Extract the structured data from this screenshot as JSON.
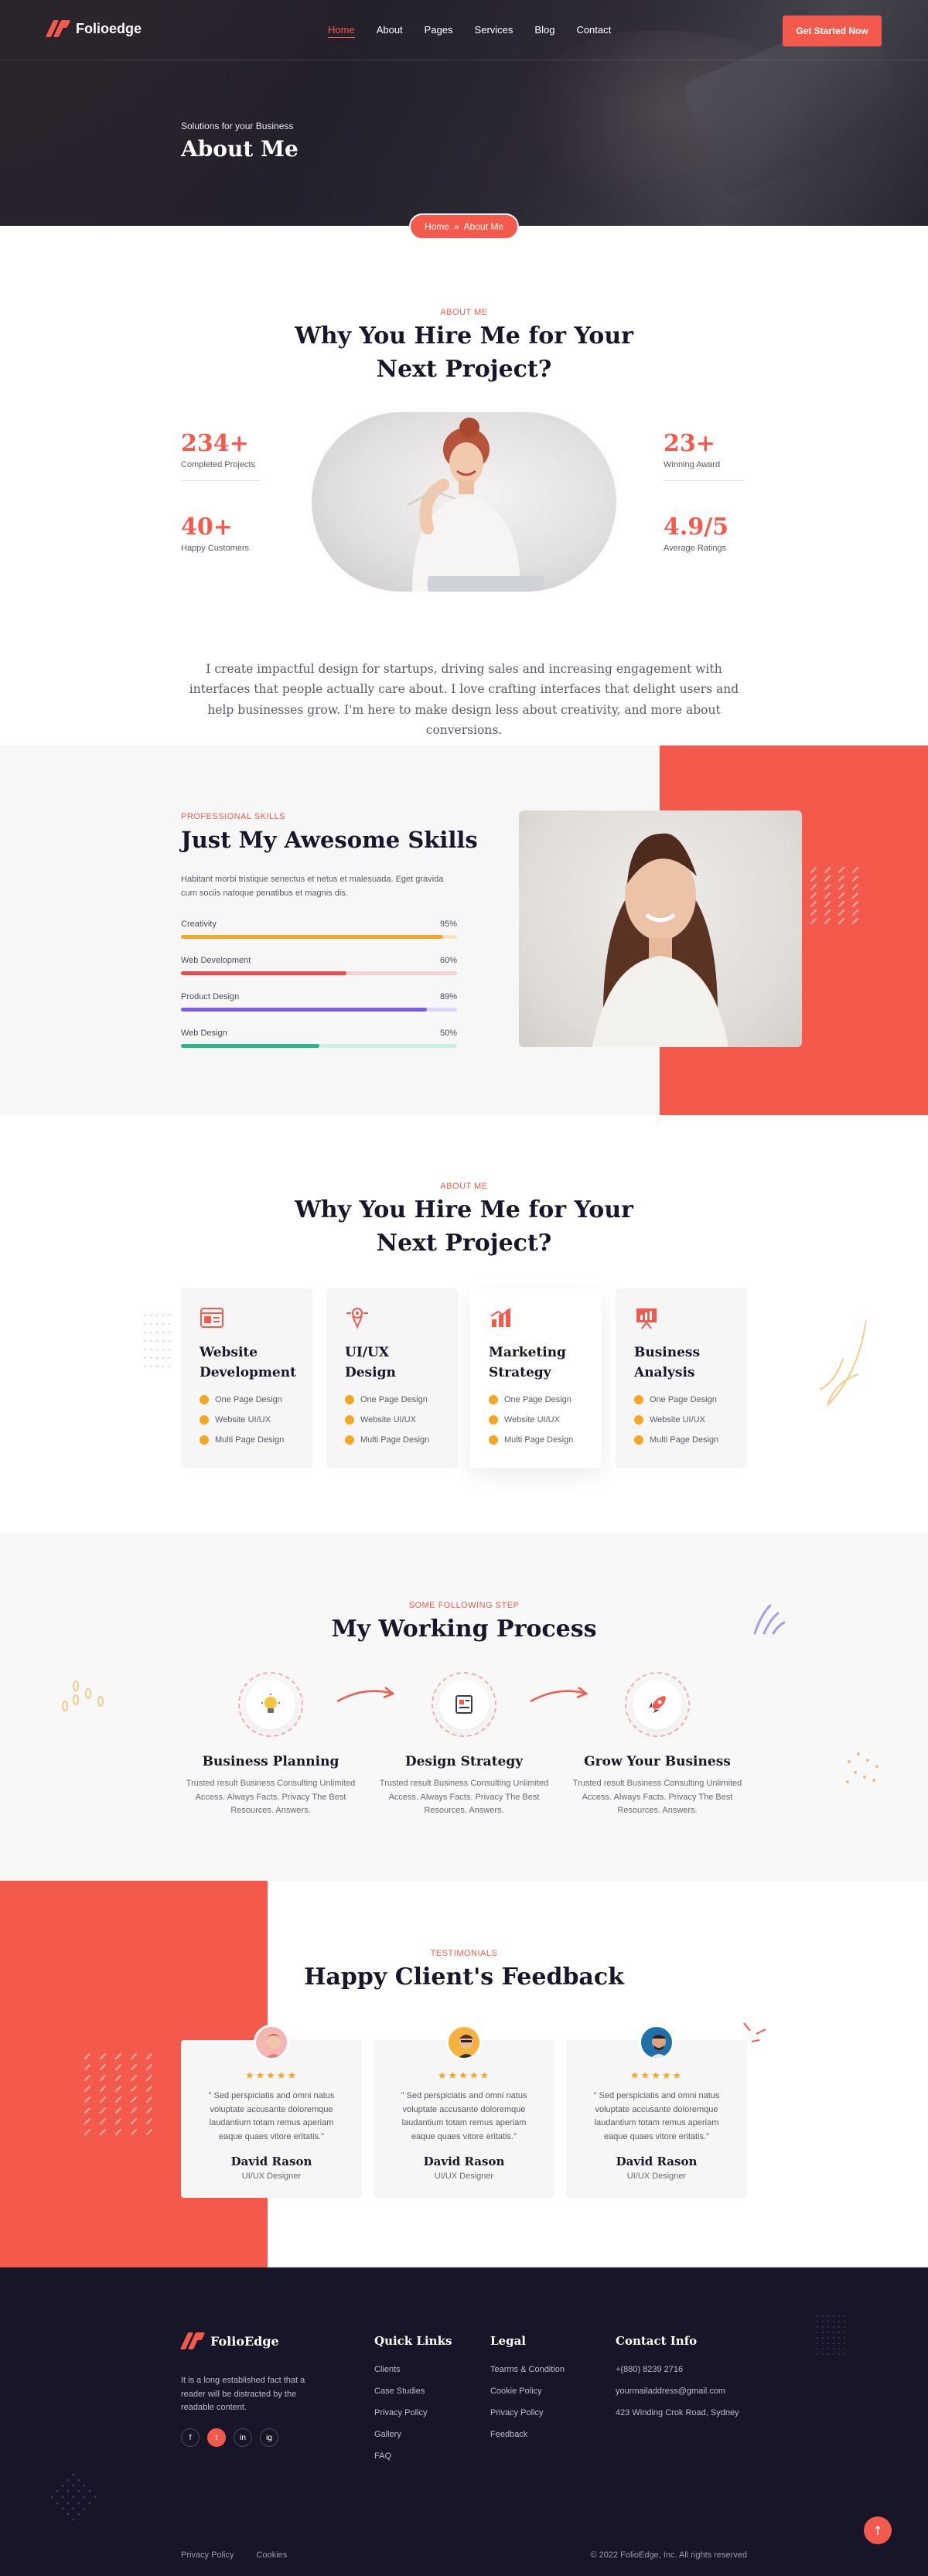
{
  "brand": {
    "name": "Folioedge",
    "accent": "#f45a4c",
    "dark": "#161628"
  },
  "nav": {
    "items": [
      {
        "label": "Home",
        "active": true
      },
      {
        "label": "About",
        "active": false
      },
      {
        "label": "Pages",
        "active": false
      },
      {
        "label": "Services",
        "active": false
      },
      {
        "label": "Blog",
        "active": false
      },
      {
        "label": "Contact",
        "active": false
      }
    ],
    "cta": "Get Started Now"
  },
  "hero": {
    "subtitle": "Solutions for your Business",
    "title": "About Me",
    "breadcrumb": {
      "home": "Home",
      "sep": "»",
      "current": "About Me"
    }
  },
  "about": {
    "eyebrow": "ABOUT ME",
    "title_line1": "Why You Hire Me for Your",
    "title_line2": "Next Project?",
    "stats": [
      {
        "value": "234+",
        "label": "Completed Projects"
      },
      {
        "value": "40+",
        "label": "Happy Customers"
      },
      {
        "value": "23+",
        "label": "Winning Award"
      },
      {
        "value": "4.9/5",
        "label": "Average Ratings"
      }
    ],
    "text": "I create impactful design for startups, driving sales and increasing engagement with interfaces that people actually care about. I love crafting interfaces that delight users and help businesses grow. I'm here to make design less about creativity, and more about conversions."
  },
  "skills": {
    "eyebrow": "PROFESSIONAL SKILLS",
    "title": "Just My Awesome Skills",
    "text": "Habitant morbi tristique senectus et netus et malesuada. Eget gravida cum sociis natoque penatibus et magnis dis.",
    "items": [
      {
        "name": "Creativity",
        "percent": "95%",
        "value": 95,
        "color": "#f5a623",
        "track": "#fbe3c0"
      },
      {
        "name": "Web Development",
        "percent": "60%",
        "value": 60,
        "color": "#e84d4d",
        "track": "#f6d0cf"
      },
      {
        "name": "Product Design",
        "percent": "89%",
        "value": 89,
        "color": "#7b5cf0",
        "track": "#ddd5fb"
      },
      {
        "name": "Web Design",
        "percent": "50%",
        "value": 50,
        "color": "#2bb58f",
        "track": "#cdeee3"
      }
    ]
  },
  "services": {
    "eyebrow": "ABOUT ME",
    "title_line1": "Why You Hire Me for Your",
    "title_line2": "Next Project?",
    "cards": [
      {
        "line1": "Website",
        "line2": "Development",
        "icon": "browser-icon",
        "features": [
          "One Page Design",
          "Website UI/UX",
          "Multi Page Design"
        ]
      },
      {
        "line1": "UI/UX",
        "line2": "Design",
        "icon": "design-pen-icon",
        "features": [
          "One Page Design",
          "Website UI/UX",
          "Multi Page Design"
        ]
      },
      {
        "line1": "Marketing",
        "line2": "Strategy",
        "icon": "bar-chart-icon",
        "features": [
          "One Page Design",
          "Website UI/UX",
          "Multi Page Design"
        ]
      },
      {
        "line1": "Business",
        "line2": "Analysis",
        "icon": "presentation-icon",
        "features": [
          "One Page Design",
          "Website UI/UX",
          "Multi Page Design"
        ]
      }
    ]
  },
  "process": {
    "eyebrow": "SOME FOLLOWING STEP",
    "title": "My Working Process",
    "steps": [
      {
        "title": "Business Planning",
        "icon": "lightbulb-icon",
        "text": "Trusted result Business Consulting Unlimited Access. Always Facts. Privacy The Best Resources. Answers."
      },
      {
        "title": "Design Strategy",
        "icon": "blueprint-icon",
        "text": "Trusted result Business Consulting Unlimited Access. Always Facts. Privacy The Best Resources. Answers."
      },
      {
        "title": "Grow Your Business",
        "icon": "rocket-icon",
        "text": "Trusted result Business Consulting Unlimited Access. Always Facts. Privacy The Best Resources. Answers."
      }
    ]
  },
  "testimonials": {
    "eyebrow": "TESTIMONIALS",
    "title": "Happy Client's Feedback",
    "items": [
      {
        "stars": "★★★★★",
        "quote": "\" Sed perspiciatis and omni natus voluptate accusante doloremque laudantium totam remus aperiam eaque quaes vitore eritatis.\"",
        "name": "David Rason",
        "role": "UI/UX Designer"
      },
      {
        "stars": "★★★★★",
        "quote": "\" Sed perspiciatis and omni natus voluptate accusante doloremque laudantium totam remus aperiam eaque quaes vitore eritatis.\"",
        "name": "David Rason",
        "role": "UI/UX Designer"
      },
      {
        "stars": "★★★★★",
        "quote": "\" Sed perspiciatis and omni natus voluptate accusante doloremque laudantium totam remus aperiam eaque quaes vitore eritatis.\"",
        "name": "David Rason",
        "role": "UI/UX Designer"
      }
    ]
  },
  "footer": {
    "brand": "FolioEdge",
    "about": "It is a long established fact that a reader will be distracted by the readable content.",
    "socials": [
      "f",
      "t",
      "in",
      "ig"
    ],
    "quick_links": {
      "title": "Quick Links",
      "items": [
        "Clients",
        "Case Studies",
        "Privacy Policy",
        "Gallery",
        "FAQ"
      ]
    },
    "legal": {
      "title": "Legal",
      "items": [
        "Tearms & Condition",
        "Cookie Policy",
        "Privacy Policy",
        "Feedback"
      ]
    },
    "contact": {
      "title": "Contact Info",
      "items": [
        "+(880) 8239 2716",
        "yourmailaddress@gmail.com",
        "423 Winding Crok Road, Sydney"
      ]
    },
    "bottom_links": [
      "Privacy Policy",
      "Cookies"
    ],
    "copyright": "© 2022 FolioEdge, Inc. All rights reserved"
  }
}
